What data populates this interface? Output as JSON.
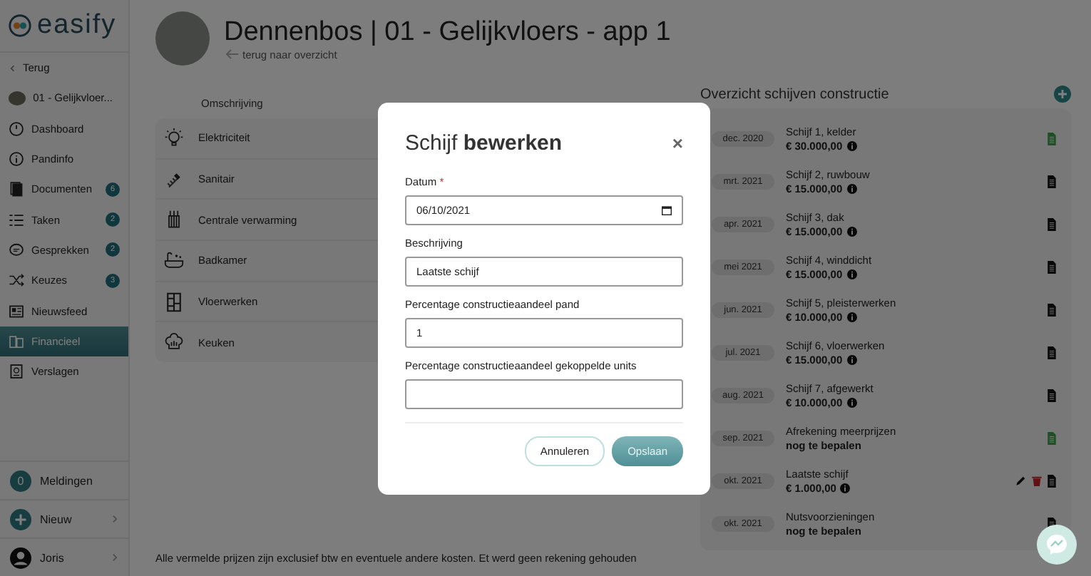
{
  "sidebar": {
    "logo": "easify",
    "back": "Terug",
    "unit": "01 - Gelijkvloer...",
    "items": [
      {
        "label": "Dashboard",
        "selected": false
      },
      {
        "label": "Pandinfo",
        "selected": false
      },
      {
        "label": "Documenten",
        "badge": "6",
        "selected": false
      },
      {
        "label": "Taken",
        "badge": "2",
        "selected": false
      },
      {
        "label": "Gesprekken",
        "badge": "2",
        "selected": false
      },
      {
        "label": "Keuzes",
        "badge": "3",
        "selected": false
      },
      {
        "label": "Nieuwsfeed",
        "selected": false
      },
      {
        "label": "Financieel",
        "selected": true
      },
      {
        "label": "Verslagen",
        "selected": false
      }
    ],
    "notifications": {
      "count": "0",
      "label": "Meldingen"
    },
    "new": "Nieuw",
    "user": "Joris"
  },
  "header": {
    "title": "Dennenbos | 01 - Gelijkvloers - app 1",
    "back_link": "terug naar overzicht"
  },
  "costs": {
    "column": "Omschrijving",
    "rows": [
      "Elektriciteit",
      "Sanitair",
      "Centrale verwarming",
      "Badkamer",
      "Vloerwerken",
      "Keuken"
    ],
    "footnote": "Alle vermelde prijzen zijn exclusief btw en eventuele andere kosten. Et werd geen rekening gehouden"
  },
  "schedule": {
    "title": "Overzicht schijven constructie",
    "items": [
      {
        "date": "dec. 2020",
        "title": "Schijf 1, kelder",
        "amount": "€ 30.000,00",
        "info": true,
        "highlighted": true,
        "editable": false
      },
      {
        "date": "mrt. 2021",
        "title": "Schijf 2, ruwbouw",
        "amount": "€ 15.000,00",
        "info": true,
        "highlighted": false,
        "editable": false
      },
      {
        "date": "apr. 2021",
        "title": "Schijf 3, dak",
        "amount": "€ 15.000,00",
        "info": true,
        "highlighted": false,
        "editable": false
      },
      {
        "date": "mei 2021",
        "title": "Schijf 4, winddicht",
        "amount": "€ 15.000,00",
        "info": true,
        "highlighted": false,
        "editable": false
      },
      {
        "date": "jun. 2021",
        "title": "Schijf 5, pleisterwerken",
        "amount": "€ 10.000,00",
        "info": true,
        "highlighted": false,
        "editable": false
      },
      {
        "date": "jul. 2021",
        "title": "Schijf 6, vloerwerken",
        "amount": "€ 15.000,00",
        "info": true,
        "highlighted": false,
        "editable": false
      },
      {
        "date": "aug. 2021",
        "title": "Schijf 7, afgewerkt",
        "amount": "€ 10.000,00",
        "info": true,
        "highlighted": false,
        "editable": false
      },
      {
        "date": "sep. 2021",
        "title": "Afrekening meerprijzen",
        "amount": "nog te bepalen",
        "info": false,
        "highlighted": true,
        "editable": false
      },
      {
        "date": "okt. 2021",
        "title": "Laatste schijf",
        "amount": "€ 1.000,00",
        "info": true,
        "highlighted": false,
        "editable": true
      },
      {
        "date": "okt. 2021",
        "title": "Nutsvoorzieningen",
        "amount": "nog te bepalen",
        "info": false,
        "highlighted": false,
        "editable": false
      }
    ]
  },
  "modal": {
    "title": "Schijf **bewerken**",
    "close": "×",
    "fields": [
      {
        "label": "Datum",
        "required": true,
        "kind": "date",
        "value": "06/10/2021"
      },
      {
        "label": "Beschrijving",
        "required": false,
        "kind": "text",
        "value": "Laatste schijf"
      },
      {
        "label": "Percentage constructieaandeel pand",
        "required": false,
        "kind": "text",
        "value": "1"
      },
      {
        "label": "Percentage constructieaandeel gekoppelde units",
        "required": false,
        "kind": "text"
      }
    ],
    "required_mark": "*",
    "cancel": "Annuleren",
    "save": "Opslaan"
  }
}
